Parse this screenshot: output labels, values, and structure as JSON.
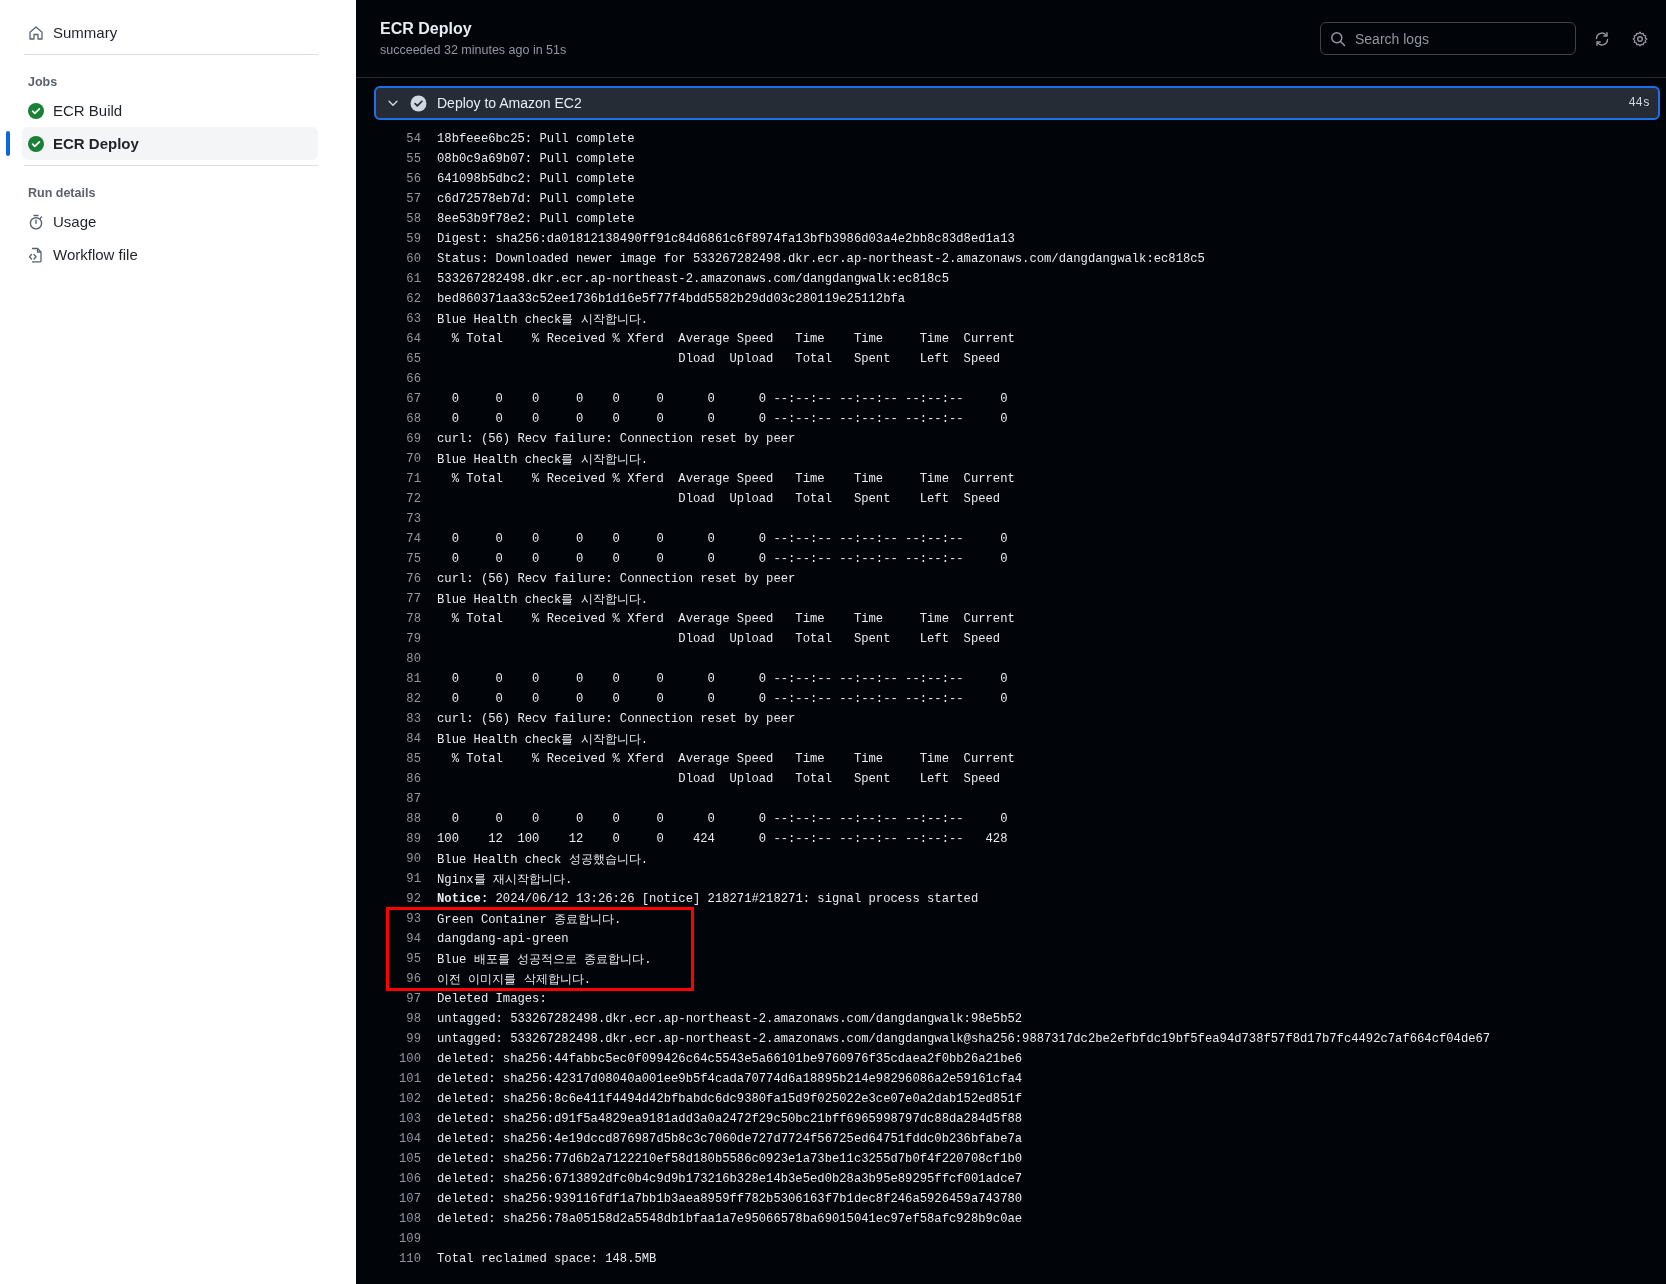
{
  "sidebar": {
    "summary": {
      "label": "Summary"
    },
    "jobs_heading": "Jobs",
    "jobs": [
      {
        "label": "ECR Build",
        "succeeded": true,
        "selected": false
      },
      {
        "label": "ECR Deploy",
        "succeeded": true,
        "selected": true
      }
    ],
    "run_details_heading": "Run details",
    "run_details": [
      {
        "label": "Usage",
        "kind": "usage"
      },
      {
        "label": "Workflow file",
        "kind": "file"
      }
    ]
  },
  "header": {
    "title": "ECR Deploy",
    "subtitle": "succeeded 32 minutes ago in 51s"
  },
  "search": {
    "placeholder": "Search logs"
  },
  "step": {
    "name": "Deploy to Amazon EC2",
    "duration": "44s",
    "expanded": true,
    "succeeded": true
  },
  "log": {
    "blocks": [
      {
        "kind": "plain",
        "lines": [
          {
            "number": "54",
            "text": "18bfeee6bc25: Pull complete"
          },
          {
            "number": "55",
            "text": "08b0c9a69b07: Pull complete"
          },
          {
            "number": "56",
            "text": "641098b5dbc2: Pull complete"
          },
          {
            "number": "57",
            "text": "c6d72578eb7d: Pull complete"
          },
          {
            "number": "58",
            "text": "8ee53b9f78e2: Pull complete"
          },
          {
            "number": "59",
            "text": "Digest: sha256:da01812138490ff91c84d6861c6f8974fa13bfb3986d03a4e2bb8c83d8ed1a13"
          },
          {
            "number": "60",
            "text": "Status: Downloaded newer image for 533267282498.dkr.ecr.ap-northeast-2.amazonaws.com/dangdangwalk:ec818c5"
          },
          {
            "number": "61",
            "text": "533267282498.dkr.ecr.ap-northeast-2.amazonaws.com/dangdangwalk:ec818c5"
          },
          {
            "number": "62",
            "text": "bed860371aa33c52ee1736b1d16e5f77f4bdd5582b29dd03c280119e25112bfa"
          },
          {
            "number": "63",
            "text": "Blue Health check를 시작합니다."
          },
          {
            "number": "64",
            "text": "  % Total    % Received % Xferd  Average Speed   Time    Time     Time  Current"
          },
          {
            "number": "65",
            "text": "                                 Dload  Upload   Total   Spent    Left  Speed"
          },
          {
            "number": "66"
          },
          {
            "number": "67",
            "text": "  0     0    0     0    0     0      0      0 --:--:-- --:--:-- --:--:--     0"
          },
          {
            "number": "68",
            "text": "  0     0    0     0    0     0      0      0 --:--:-- --:--:-- --:--:--     0"
          },
          {
            "number": "69",
            "text": "curl: (56) Recv failure: Connection reset by peer"
          },
          {
            "number": "70",
            "text": "Blue Health check를 시작합니다."
          },
          {
            "number": "71",
            "text": "  % Total    % Received % Xferd  Average Speed   Time    Time     Time  Current"
          },
          {
            "number": "72",
            "text": "                                 Dload  Upload   Total   Spent    Left  Speed"
          },
          {
            "number": "73"
          },
          {
            "number": "74",
            "text": "  0     0    0     0    0     0      0      0 --:--:-- --:--:-- --:--:--     0"
          },
          {
            "number": "75",
            "text": "  0     0    0     0    0     0      0      0 --:--:-- --:--:-- --:--:--     0"
          },
          {
            "number": "76",
            "text": "curl: (56) Recv failure: Connection reset by peer"
          },
          {
            "number": "77",
            "text": "Blue Health check를 시작합니다."
          },
          {
            "number": "78",
            "text": "  % Total    % Received % Xferd  Average Speed   Time    Time     Time  Current"
          },
          {
            "number": "79",
            "text": "                                 Dload  Upload   Total   Spent    Left  Speed"
          },
          {
            "number": "80"
          },
          {
            "number": "81",
            "text": "  0     0    0     0    0     0      0      0 --:--:-- --:--:-- --:--:--     0"
          },
          {
            "number": "82",
            "text": "  0     0    0     0    0     0      0      0 --:--:-- --:--:-- --:--:--     0"
          },
          {
            "number": "83",
            "text": "curl: (56) Recv failure: Connection reset by peer"
          },
          {
            "number": "84",
            "text": "Blue Health check를 시작합니다."
          },
          {
            "number": "85",
            "text": "  % Total    % Received % Xferd  Average Speed   Time    Time     Time  Current"
          },
          {
            "number": "86",
            "text": "                                 Dload  Upload   Total   Spent    Left  Speed"
          },
          {
            "number": "87"
          },
          {
            "number": "88",
            "text": "  0     0    0     0    0     0      0      0 --:--:-- --:--:-- --:--:--     0"
          },
          {
            "number": "89",
            "text": "100    12  100    12    0     0    424      0 --:--:-- --:--:-- --:--:--   428"
          },
          {
            "number": "90",
            "text": "Blue Health check 성공했습니다."
          },
          {
            "number": "91",
            "text": "Nginx를 재시작합니다."
          },
          {
            "number": "92",
            "text": "**Notice:** 2024/06/12 13:26:26 [notice] 218271#218271: signal process started"
          }
        ]
      },
      {
        "kind": "highlight",
        "lines": [
          {
            "number": "93",
            "text": "Green Container 종료합니다."
          },
          {
            "number": "94",
            "text": "dangdang-api-green"
          },
          {
            "number": "95",
            "text": "Blue 배포를 성공적으로 종료합니다."
          },
          {
            "number": "96",
            "text": "이전 이미지를 삭제합니다."
          }
        ]
      },
      {
        "kind": "plain",
        "lines": [
          {
            "number": "97",
            "text": "Deleted Images:"
          },
          {
            "number": "98",
            "text": "untagged: 533267282498.dkr.ecr.ap-northeast-2.amazonaws.com/dangdangwalk:98e5b52"
          },
          {
            "number": "99",
            "text": "untagged: 533267282498.dkr.ecr.ap-northeast-2.amazonaws.com/dangdangwalk@sha256:9887317dc2be2efbfdc19bf5fea94d738f57f8d17b7fc4492c7af664cf04de67"
          },
          {
            "number": "100",
            "text": "deleted: sha256:44fabbc5ec0f099426c64c5543e5a66101be9760976f35cdaea2f0bb26a21be6"
          },
          {
            "number": "101",
            "text": "deleted: sha256:42317d08040a001ee9b5f4cada70774d6a18895b214e98296086a2e59161cfa4"
          },
          {
            "number": "102",
            "text": "deleted: sha256:8c6e411f4494d42bfbabdc6dc9380fa15d9f025022e3ce07e0a2dab152ed851f"
          },
          {
            "number": "103",
            "text": "deleted: sha256:d91f5a4829ea9181add3a0a2472f29c50bc21bff6965998797dc88da284d5f88"
          },
          {
            "number": "104",
            "text": "deleted: sha256:4e19dccd876987d5b8c3c7060de727d7724f56725ed64751fddc0b236bfabe7a"
          },
          {
            "number": "105",
            "text": "deleted: sha256:77d6b2a7122210ef58d180b5586c0923e1a73be11c3255d7b0f4f220708cf1b0"
          },
          {
            "number": "106",
            "text": "deleted: sha256:6713892dfc0b4c9d9b173216b328e14b3e5ed0b28a3b95e89295ffcf001adce7"
          },
          {
            "number": "107",
            "text": "deleted: sha256:939116fdf1a7bb1b3aea8959ff782b5306163f7b1dec8f246a5926459a743780"
          },
          {
            "number": "108",
            "text": "deleted: sha256:78a05158d2a5548db1bfaa1a7e95066578ba69015041ec97ef58afc928b9c0ae"
          },
          {
            "number": "109"
          },
          {
            "number": "110",
            "text": "Total reclaimed space: 148.5MB"
          }
        ]
      }
    ]
  }
}
